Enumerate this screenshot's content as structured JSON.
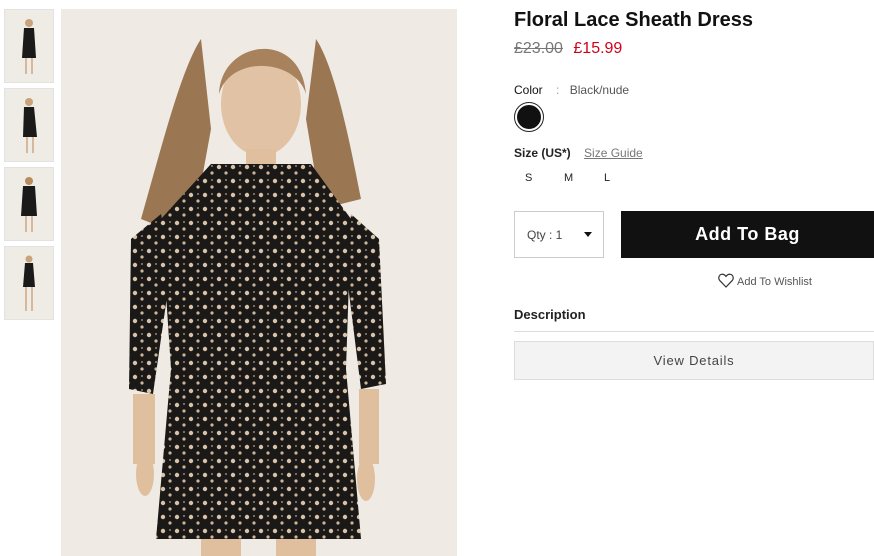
{
  "product": {
    "title": "Floral Lace Sheath Dress",
    "price_old": "£23.00",
    "price_new": "£15.99"
  },
  "color": {
    "label": "Color",
    "separator": ":",
    "value": "Black/nude",
    "swatch_hex": "#111111"
  },
  "size": {
    "label": "Size (US*)",
    "guide_label": "Size Guide",
    "options": [
      "S",
      "M",
      "L"
    ]
  },
  "qty": {
    "label": "Qty : 1"
  },
  "actions": {
    "add_to_bag": "Add To Bag",
    "wishlist": "Add To Wishlist"
  },
  "description": {
    "heading": "Description",
    "view_details": "View Details"
  },
  "colors": {
    "price_sale": "#d0021b",
    "button_bg": "#111111",
    "image_bg": "#efebe4"
  },
  "thumbnails": [
    {
      "icon": "model-front-thumbnail"
    },
    {
      "icon": "model-side-thumbnail"
    },
    {
      "icon": "model-back-thumbnail"
    },
    {
      "icon": "model-full-thumbnail"
    }
  ]
}
